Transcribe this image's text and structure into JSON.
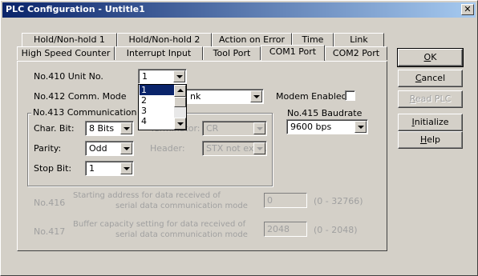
{
  "window": {
    "title": "PLC Configuration - Untitle1",
    "close_glyph": "✕"
  },
  "tabs": {
    "row1": [
      "Hold/Non-hold 1",
      "Hold/Non-hold 2",
      "Action on Error",
      "Time",
      "Link"
    ],
    "row2": [
      "High Speed Counter",
      "Interrupt Input",
      "Tool Port",
      "COM1 Port",
      "COM2 Port"
    ],
    "active": "COM1 Port"
  },
  "unit_no": {
    "label": "No.410  Unit No.",
    "value": "1",
    "options": [
      "1",
      "2",
      "3",
      "4"
    ],
    "selected": "1"
  },
  "comm_mode": {
    "label": "No.412  Comm. Mode",
    "value_visible": "nk"
  },
  "modem": {
    "label": "Modem Enabled",
    "checked": false
  },
  "comm_format": {
    "group_label": "No.413 Communication For",
    "char_bit": {
      "label": "Char. Bit:",
      "value": "8 Bits"
    },
    "terminator": {
      "label": "Terminator:",
      "value": "CR"
    },
    "parity": {
      "label": "Parity:",
      "value": "Odd"
    },
    "header": {
      "label": "Header:",
      "value": "STX not exist."
    },
    "stop_bit": {
      "label": "Stop Bit:",
      "value": "1"
    }
  },
  "baudrate": {
    "label": "No.415  Baudrate",
    "value": "9600 bps"
  },
  "start_addr": {
    "no": "No.416",
    "line1": "Starting address for data received of",
    "line2": "serial data communication mode",
    "value": "0",
    "range": "(0 - 32766)"
  },
  "buffer_cap": {
    "no": "No.417",
    "line1": "Buffer capacity setting for data received of",
    "line2": "serial data communication mode",
    "value": "2048",
    "range": "(0 - 2048)"
  },
  "buttons": {
    "ok": {
      "access": "O",
      "rest": "K"
    },
    "cancel": {
      "access": "C",
      "rest": "ancel"
    },
    "read_plc": {
      "access": "R",
      "rest": "ead PLC"
    },
    "initialize": {
      "access": "I",
      "rest": "nitialize"
    },
    "help": {
      "access": "H",
      "rest": "elp"
    }
  },
  "colors": {
    "title_start": "#0a246a",
    "title_end": "#a6caf0",
    "face": "#d4d0c8",
    "selection": "#0a246a"
  }
}
